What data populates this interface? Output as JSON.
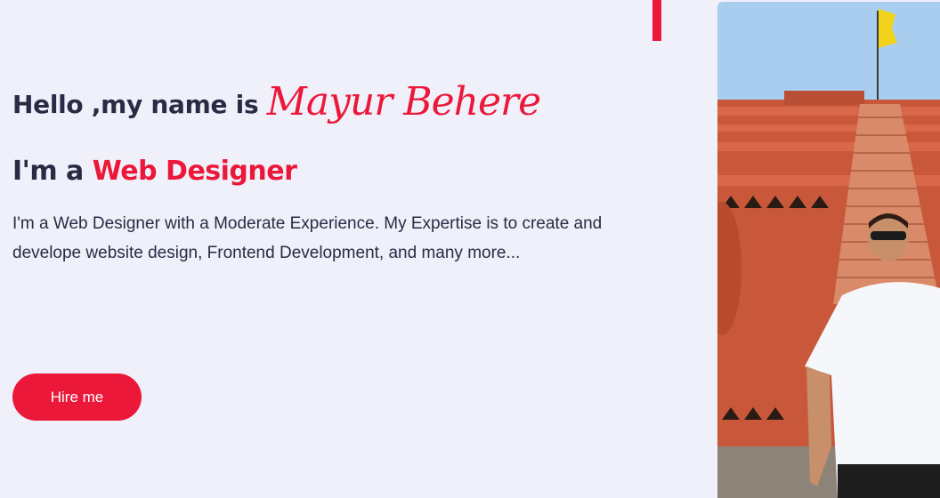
{
  "hero": {
    "greeting_prefix": "Hello ,my name is",
    "name": "Mayur Behere",
    "role_prefix": "I'm a",
    "role": "Web Designer",
    "intro": "I'm a Web Designer with a Moderate Experience. My Expertise is to create and develope website design, Frontend Development, and many more...",
    "hire_label": "Hire me"
  },
  "colors": {
    "accent": "#ec1839",
    "text": "#2a2a44",
    "background": "#f0f0fa"
  },
  "photo": {
    "subject": "portrait-photo"
  }
}
